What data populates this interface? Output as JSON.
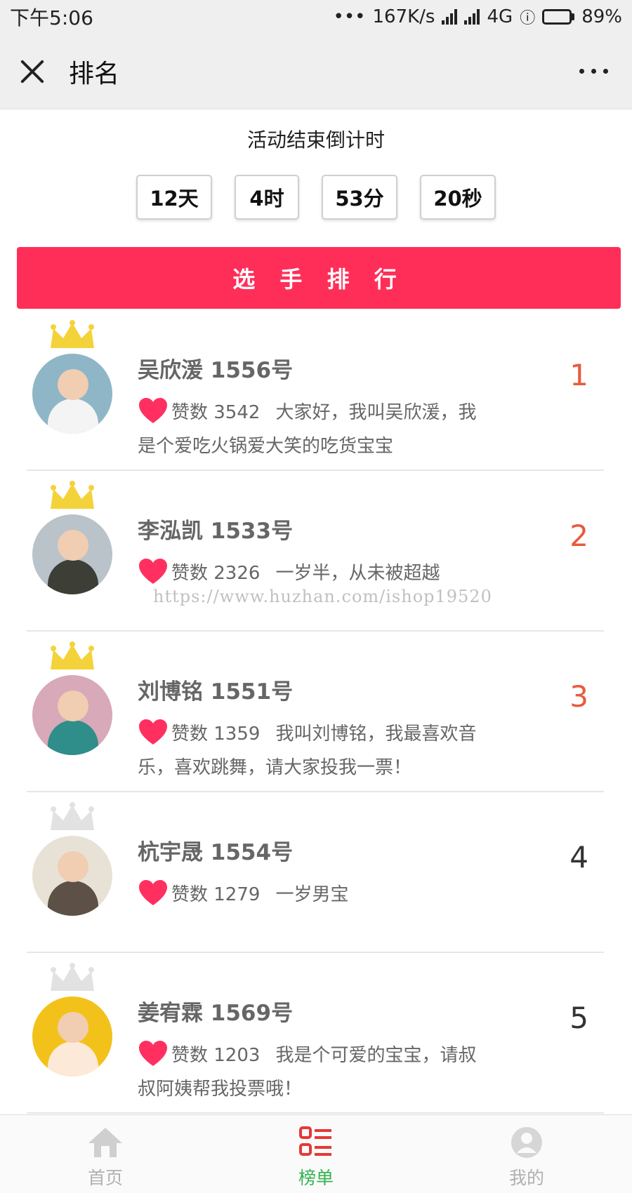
{
  "status_bar": {
    "time": "下午5:06",
    "dots": "•••",
    "speed": "167K/s",
    "network": "4G",
    "battery": "89%"
  },
  "title_bar": {
    "title": "排名"
  },
  "countdown": {
    "label": "活动结束倒计时",
    "days": "12天",
    "hours": "4时",
    "minutes": "53分",
    "seconds": "20秒"
  },
  "ranking_header": "选 手 排 行",
  "contestants": [
    {
      "name": "吴欣湲  1556号",
      "votes": "赞数 3542",
      "intro": "大家好，我叫吴欣湲，我是个爱吃火锅爱大笑的吃货宝宝",
      "rank": "1",
      "crown": "gold"
    },
    {
      "name": "李泓凯  1533号",
      "votes": "赞数 2326",
      "intro": "一岁半，从未被超越",
      "rank": "2",
      "crown": "gold"
    },
    {
      "name": "刘博铭  1551号",
      "votes": "赞数 1359",
      "intro": "我叫刘博铭，我最喜欢音乐，喜欢跳舞，请大家投我一票！",
      "rank": "3",
      "crown": "gold"
    },
    {
      "name": "杭宇晟  1554号",
      "votes": "赞数 1279",
      "intro": "一岁男宝",
      "rank": "4",
      "crown": "silver"
    },
    {
      "name": "姜宥霖  1569号",
      "votes": "赞数 1203",
      "intro": "我是个可爱的宝宝，请叔叔阿姨帮我投票哦！",
      "rank": "5",
      "crown": "silver"
    }
  ],
  "watermark": "https://www.huzhan.com/ishop19520",
  "tabbar": {
    "home": "首页",
    "ranking": "榜单",
    "mine": "我的"
  },
  "colors": {
    "accent": "#ff2e58",
    "rank_top": "#e85a3c",
    "tab_active": "#33b24f",
    "heart": "#ff3060",
    "crown_gold": "#f4d23a",
    "crown_silver": "#e2e2e2"
  }
}
